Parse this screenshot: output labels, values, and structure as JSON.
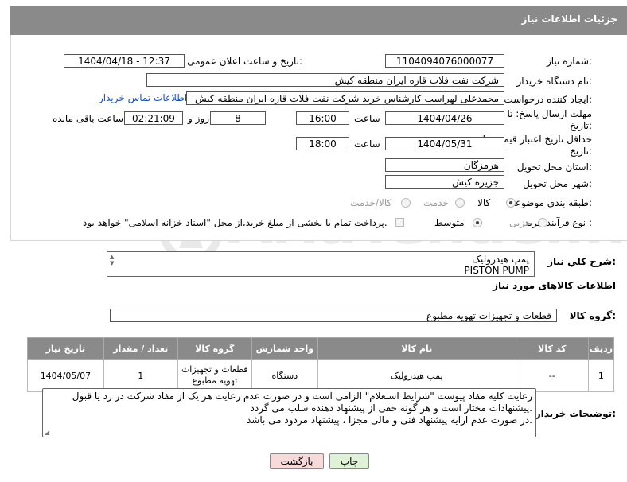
{
  "header": {
    "title": "جزئیات اطلاعات نیاز"
  },
  "fields": {
    "need_number_label": "شماره نیاز:",
    "need_number": "1104094076000077",
    "announce_label": "تاریخ و ساعت اعلان عمومی:",
    "announce_value": "1404/04/18 - 12:37",
    "buyer_org_label": "نام دستگاه خریدار:",
    "buyer_org": "شرکت نفت فلات قاره ایران منطقه کیش",
    "creator_label": "ایجاد کننده درخواست:",
    "creator": "محمدعلی لهراسب کارشناس خرید شرکت نفت فلات قاره ایران منطقه کیش",
    "contact_link": "اطلاعات تماس خریدار",
    "reply_deadline_label": "مهلت ارسال پاسخ: تا تاریخ:",
    "reply_date": "1404/04/26",
    "time_label": "ساعت",
    "reply_time": "16:00",
    "days_value": "8",
    "days_label": "روز و",
    "remaining_time": "02:21:09",
    "remaining_label": "ساعت باقی مانده",
    "price_deadline_label": "حداقل تاریخ اعتبار قیمت: تا تاریخ:",
    "price_date": "1404/05/31",
    "price_time": "18:00",
    "province_label": "استان محل تحویل:",
    "province": "هرمزگان",
    "city_label": "شهر محل تحویل:",
    "city": "جزیره کیش",
    "category_label": "طبقه بندی موضوعی:",
    "category_options": [
      "کالا",
      "خدمت",
      "کالا/خدمت"
    ],
    "process_label": "نوع فرآیند خرید :",
    "process_options": [
      "جزیی",
      "متوسط"
    ],
    "payment_note": "پرداخت تمام یا بخشی از مبلغ خرید،از محل \"اسناد خزانه اسلامی\" خواهد بود."
  },
  "description": {
    "label": "شرح کلي نياز:",
    "line1": "پمپ هیدرولیک",
    "line2": "PISTON PUMP"
  },
  "goods": {
    "section_title": "اطلاعات کالاهای مورد نیاز",
    "group_label": "گروه کالا:",
    "group_value": "قطعات و تجهیزات تهویه مطبوع",
    "columns": [
      "ردیف",
      "کد کالا",
      "نام کالا",
      "واحد شمارش",
      "گروه کالا",
      "تعداد / مقدار",
      "تاریخ نیاز"
    ],
    "rows": [
      [
        "1",
        "--",
        "پمپ هیدرولیک",
        "دستگاه",
        "قطعات و تجهیزات تهویه مطبوع",
        "1",
        "1404/05/07"
      ]
    ]
  },
  "buyer_notes": {
    "label": "توضیحات خریدار:",
    "line1": "رعایت کلیه مفاد  پیوست \"شرایط استعلام\" الزامی است و در صورت عدم رعایت هر یک از مفاد شرکت در رد یا قبول",
    "line2": "پیشنهادات مختار است  و هر گونه حقی از پیشنهاد دهنده سلب می گردد.",
    "line3": "در صورت عدم ارایه پیشنهاد فنی و مالی مجزا ، پیشنهاد مردود می باشد."
  },
  "buttons": {
    "print": "چاپ",
    "back": "بازگشت"
  },
  "watermark": {
    "text": "AriaTender.net"
  },
  "colors": {
    "header_bg": "#8a8a8a",
    "link": "#1a4fbd",
    "back_button_bg": "#f5d6d6",
    "print_button_bg": "#d9f0d0"
  }
}
